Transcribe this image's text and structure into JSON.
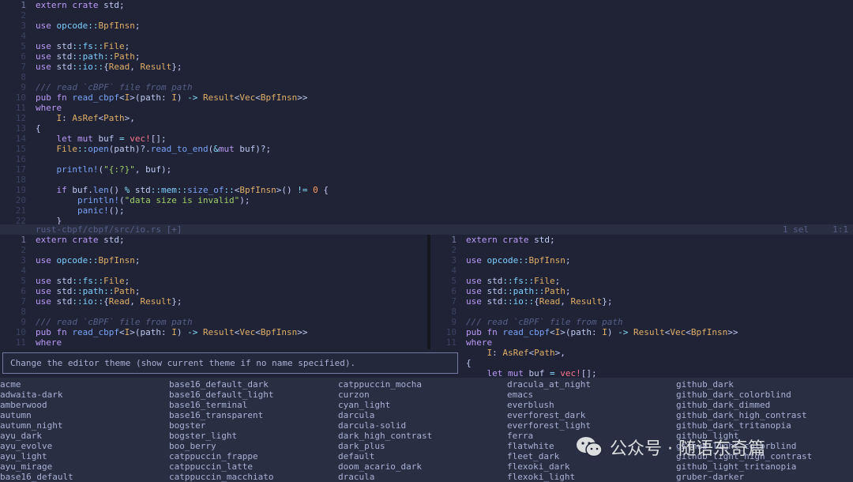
{
  "top_pane": {
    "lines": [
      {
        "n": "1",
        "cur": true,
        "t": [
          [
            "k",
            "extern"
          ],
          [
            "",
            " "
          ],
          [
            "k",
            "crate"
          ],
          [
            "",
            " std;"
          ]
        ]
      },
      {
        "n": "2",
        "t": []
      },
      {
        "n": "3",
        "t": [
          [
            "k",
            "use"
          ],
          [
            "",
            " "
          ],
          [
            "ns",
            "opcode"
          ],
          [
            "op",
            "::"
          ],
          [
            "ty",
            "BpfInsn"
          ],
          [
            "",
            ";"
          ]
        ]
      },
      {
        "n": "4",
        "t": []
      },
      {
        "n": "5",
        "t": [
          [
            "k",
            "use"
          ],
          [
            "",
            " std"
          ],
          [
            "op",
            "::"
          ],
          [
            "ns",
            "fs"
          ],
          [
            "op",
            "::"
          ],
          [
            "ty",
            "File"
          ],
          [
            "",
            ";"
          ]
        ]
      },
      {
        "n": "6",
        "t": [
          [
            "k",
            "use"
          ],
          [
            "",
            " std"
          ],
          [
            "op",
            "::"
          ],
          [
            "ns",
            "path"
          ],
          [
            "op",
            "::"
          ],
          [
            "ty",
            "Path"
          ],
          [
            "",
            ";"
          ]
        ]
      },
      {
        "n": "7",
        "t": [
          [
            "k",
            "use"
          ],
          [
            "",
            " std"
          ],
          [
            "op",
            "::"
          ],
          [
            "ns",
            "io"
          ],
          [
            "op",
            "::"
          ],
          [
            "",
            "{"
          ],
          [
            "ty",
            "Read"
          ],
          [
            "",
            ", "
          ],
          [
            "ty",
            "Result"
          ],
          [
            "",
            "};"
          ]
        ]
      },
      {
        "n": "8",
        "t": []
      },
      {
        "n": "9",
        "t": [
          [
            "cm",
            "/// read `cBPF` file from path"
          ]
        ]
      },
      {
        "n": "10",
        "t": [
          [
            "k",
            "pub fn"
          ],
          [
            "",
            " "
          ],
          [
            "fn",
            "read_cbpf"
          ],
          [
            "",
            "<"
          ],
          [
            "ty",
            "I"
          ],
          [
            "",
            ">(path: "
          ],
          [
            "ty",
            "I"
          ],
          [
            "",
            ") "
          ],
          [
            "op",
            "->"
          ],
          [
            "",
            " "
          ],
          [
            "ty",
            "Result"
          ],
          [
            "",
            "<"
          ],
          [
            "ty",
            "Vec"
          ],
          [
            "",
            "<"
          ],
          [
            "ty",
            "BpfInsn"
          ],
          [
            "",
            ">>"
          ]
        ]
      },
      {
        "n": "11",
        "t": [
          [
            "k",
            "where"
          ]
        ]
      },
      {
        "n": "12",
        "t": [
          [
            "",
            "    "
          ],
          [
            "ty",
            "I"
          ],
          [
            "",
            ": "
          ],
          [
            "ty",
            "AsRef"
          ],
          [
            "",
            "<"
          ],
          [
            "ty",
            "Path"
          ],
          [
            "",
            ">,"
          ]
        ]
      },
      {
        "n": "13",
        "t": [
          [
            "",
            "{"
          ]
        ]
      },
      {
        "n": "14",
        "t": [
          [
            "",
            "    "
          ],
          [
            "k",
            "let mut"
          ],
          [
            "",
            " buf "
          ],
          [
            "op",
            "="
          ],
          [
            "",
            " "
          ],
          [
            "pr",
            "vec!"
          ],
          [
            "",
            "[];"
          ]
        ]
      },
      {
        "n": "15",
        "t": [
          [
            "",
            "    "
          ],
          [
            "ty",
            "File"
          ],
          [
            "op",
            "::"
          ],
          [
            "fn",
            "open"
          ],
          [
            "",
            "(path)?."
          ],
          [
            "fn",
            "read_to_end"
          ],
          [
            "",
            "("
          ],
          [
            "op",
            "&"
          ],
          [
            "k",
            "mut"
          ],
          [
            "",
            " buf)?;"
          ]
        ]
      },
      {
        "n": "16",
        "t": []
      },
      {
        "n": "17",
        "t": [
          [
            "",
            "    "
          ],
          [
            "fn",
            "println!"
          ],
          [
            "",
            "("
          ],
          [
            "str",
            "\"{:?}\""
          ],
          [
            "",
            ", buf);"
          ]
        ]
      },
      {
        "n": "18",
        "t": []
      },
      {
        "n": "19",
        "t": [
          [
            "",
            "    "
          ],
          [
            "k",
            "if"
          ],
          [
            "",
            " buf."
          ],
          [
            "fn",
            "len"
          ],
          [
            "",
            "() "
          ],
          [
            "op",
            "%"
          ],
          [
            "",
            " std"
          ],
          [
            "op",
            "::"
          ],
          [
            "ns",
            "mem"
          ],
          [
            "op",
            "::"
          ],
          [
            "fn",
            "size_of"
          ],
          [
            "op",
            "::"
          ],
          [
            "",
            "<"
          ],
          [
            "ty",
            "BpfInsn"
          ],
          [
            "",
            ">() "
          ],
          [
            "op",
            "!="
          ],
          [
            "",
            " "
          ],
          [
            "num",
            "0"
          ],
          [
            "",
            " {"
          ]
        ]
      },
      {
        "n": "20",
        "t": [
          [
            "",
            "        "
          ],
          [
            "fn",
            "println!"
          ],
          [
            "",
            "("
          ],
          [
            "str",
            "\"data size is invalid\""
          ],
          [
            "",
            ");"
          ]
        ]
      },
      {
        "n": "21",
        "t": [
          [
            "",
            "        "
          ],
          [
            "fn",
            "panic!"
          ],
          [
            "",
            "();"
          ]
        ]
      },
      {
        "n": "22",
        "t": [
          [
            "",
            "    }"
          ]
        ]
      }
    ]
  },
  "status_bar": {
    "file": "rust-cbpf/cbpf/src/io.rs [+]",
    "selection": "1 sel",
    "position": "1:1"
  },
  "bottom_left_pane": {
    "lines": [
      {
        "n": "1",
        "cur": true,
        "t": [
          [
            "k",
            "extern"
          ],
          [
            "",
            " "
          ],
          [
            "k",
            "crate"
          ],
          [
            "",
            " std;"
          ]
        ]
      },
      {
        "n": "2",
        "t": []
      },
      {
        "n": "3",
        "t": [
          [
            "k",
            "use"
          ],
          [
            "",
            " "
          ],
          [
            "ns",
            "opcode"
          ],
          [
            "op",
            "::"
          ],
          [
            "ty",
            "BpfInsn"
          ],
          [
            "",
            ";"
          ]
        ]
      },
      {
        "n": "4",
        "t": []
      },
      {
        "n": "5",
        "t": [
          [
            "k",
            "use"
          ],
          [
            "",
            " std"
          ],
          [
            "op",
            "::"
          ],
          [
            "ns",
            "fs"
          ],
          [
            "op",
            "::"
          ],
          [
            "ty",
            "File"
          ],
          [
            "",
            ";"
          ]
        ]
      },
      {
        "n": "6",
        "t": [
          [
            "k",
            "use"
          ],
          [
            "",
            " std"
          ],
          [
            "op",
            "::"
          ],
          [
            "ns",
            "path"
          ],
          [
            "op",
            "::"
          ],
          [
            "ty",
            "Path"
          ],
          [
            "",
            ";"
          ]
        ]
      },
      {
        "n": "7",
        "t": [
          [
            "k",
            "use"
          ],
          [
            "",
            " std"
          ],
          [
            "op",
            "::"
          ],
          [
            "ns",
            "io"
          ],
          [
            "op",
            "::"
          ],
          [
            "",
            "{"
          ],
          [
            "ty",
            "Read"
          ],
          [
            "",
            ", "
          ],
          [
            "ty",
            "Result"
          ],
          [
            "",
            "};"
          ]
        ]
      },
      {
        "n": "8",
        "t": []
      },
      {
        "n": "9",
        "t": [
          [
            "cm",
            "/// read `cBPF` file from path"
          ]
        ]
      },
      {
        "n": "10",
        "t": [
          [
            "k",
            "pub fn"
          ],
          [
            "",
            " "
          ],
          [
            "fn",
            "read_cbpf"
          ],
          [
            "",
            "<"
          ],
          [
            "ty",
            "I"
          ],
          [
            "",
            ">(path: "
          ],
          [
            "ty",
            "I"
          ],
          [
            "",
            ") "
          ],
          [
            "op",
            "->"
          ],
          [
            "",
            " "
          ],
          [
            "ty",
            "Result"
          ],
          [
            "",
            "<"
          ],
          [
            "ty",
            "Vec"
          ],
          [
            "",
            "<"
          ],
          [
            "ty",
            "BpfInsn"
          ],
          [
            "",
            ">>"
          ]
        ]
      },
      {
        "n": "11",
        "t": [
          [
            "k",
            "where"
          ]
        ]
      }
    ]
  },
  "bottom_right_pane": {
    "lines": [
      {
        "n": "1",
        "cur": true,
        "t": [
          [
            "k",
            "extern"
          ],
          [
            "",
            " "
          ],
          [
            "k",
            "crate"
          ],
          [
            "",
            " std;"
          ]
        ]
      },
      {
        "n": "2",
        "t": []
      },
      {
        "n": "3",
        "t": [
          [
            "k",
            "use"
          ],
          [
            "",
            " "
          ],
          [
            "ns",
            "opcode"
          ],
          [
            "op",
            "::"
          ],
          [
            "ty",
            "BpfInsn"
          ],
          [
            "",
            ";"
          ]
        ]
      },
      {
        "n": "4",
        "t": []
      },
      {
        "n": "5",
        "t": [
          [
            "k",
            "use"
          ],
          [
            "",
            " std"
          ],
          [
            "op",
            "::"
          ],
          [
            "ns",
            "fs"
          ],
          [
            "op",
            "::"
          ],
          [
            "ty",
            "File"
          ],
          [
            "",
            ";"
          ]
        ]
      },
      {
        "n": "6",
        "t": [
          [
            "k",
            "use"
          ],
          [
            "",
            " std"
          ],
          [
            "op",
            "::"
          ],
          [
            "ns",
            "path"
          ],
          [
            "op",
            "::"
          ],
          [
            "ty",
            "Path"
          ],
          [
            "",
            ";"
          ]
        ]
      },
      {
        "n": "7",
        "t": [
          [
            "k",
            "use"
          ],
          [
            "",
            " std"
          ],
          [
            "op",
            "::"
          ],
          [
            "ns",
            "io"
          ],
          [
            "op",
            "::"
          ],
          [
            "",
            "{"
          ],
          [
            "ty",
            "Read"
          ],
          [
            "",
            ", "
          ],
          [
            "ty",
            "Result"
          ],
          [
            "",
            "};"
          ]
        ]
      },
      {
        "n": "8",
        "t": []
      },
      {
        "n": "9",
        "t": [
          [
            "cm",
            "/// read `cBPF` file from path"
          ]
        ]
      },
      {
        "n": "10",
        "t": [
          [
            "k",
            "pub fn"
          ],
          [
            "",
            " "
          ],
          [
            "fn",
            "read_cbpf"
          ],
          [
            "",
            "<"
          ],
          [
            "ty",
            "I"
          ],
          [
            "",
            ">(path: "
          ],
          [
            "ty",
            "I"
          ],
          [
            "",
            ") "
          ],
          [
            "op",
            "->"
          ],
          [
            "",
            " "
          ],
          [
            "ty",
            "Result"
          ],
          [
            "",
            "<"
          ],
          [
            "ty",
            "Vec"
          ],
          [
            "",
            "<"
          ],
          [
            "ty",
            "BpfInsn"
          ],
          [
            "",
            ">>"
          ]
        ]
      },
      {
        "n": "11",
        "t": [
          [
            "k",
            "where"
          ]
        ]
      },
      {
        "n": "",
        "t": [
          [
            "",
            "    "
          ],
          [
            "ty",
            "I"
          ],
          [
            "",
            ": "
          ],
          [
            "ty",
            "AsRef"
          ],
          [
            "",
            "<"
          ],
          [
            "ty",
            "Path"
          ],
          [
            "",
            ">,"
          ]
        ]
      },
      {
        "n": "",
        "t": [
          [
            "",
            "{"
          ]
        ]
      },
      {
        "n": "",
        "t": [
          [
            "",
            "    "
          ],
          [
            "k",
            "let mut"
          ],
          [
            "",
            " buf "
          ],
          [
            "op",
            "="
          ],
          [
            "",
            " "
          ],
          [
            "pr",
            "vec!"
          ],
          [
            "",
            "[];"
          ]
        ]
      }
    ]
  },
  "command_prompt": {
    "text": "Change the editor theme (show current theme if no name specified)."
  },
  "theme_menu": {
    "columns": [
      [
        "acme",
        "adwaita-dark",
        "amberwood",
        "autumn",
        "autumn_night",
        "ayu_dark",
        "ayu_evolve",
        "ayu_light",
        "ayu_mirage",
        "base16_default"
      ],
      [
        "base16_default_dark",
        "base16_default_light",
        "base16_terminal",
        "base16_transparent",
        "bogster",
        "bogster_light",
        "boo_berry",
        "catppuccin_frappe",
        "catppuccin_latte",
        "catppuccin_macchiato"
      ],
      [
        "catppuccin_mocha",
        "curzon",
        "cyan_light",
        "darcula",
        "darcula-solid",
        "dark_high_contrast",
        "dark_plus",
        "default",
        "doom_acario_dark",
        "dracula"
      ],
      [
        "dracula_at_night",
        "emacs",
        "everblush",
        "everforest_dark",
        "everforest_light",
        "ferra",
        "flatwhite",
        "fleet_dark",
        "flexoki_dark",
        "flexoki_light"
      ],
      [
        "github_dark",
        "github_dark_colorblind",
        "github_dark_dimmed",
        "github_dark_high_contrast",
        "github_dark_tritanopia",
        "github_light",
        "github_light_colorblind",
        "github_light_high_contrast",
        "github_light_tritanopia",
        "gruber-darker"
      ]
    ]
  },
  "watermark": {
    "text": "公众号 · 随语东奇篇",
    "icon": "wechat-icon"
  }
}
